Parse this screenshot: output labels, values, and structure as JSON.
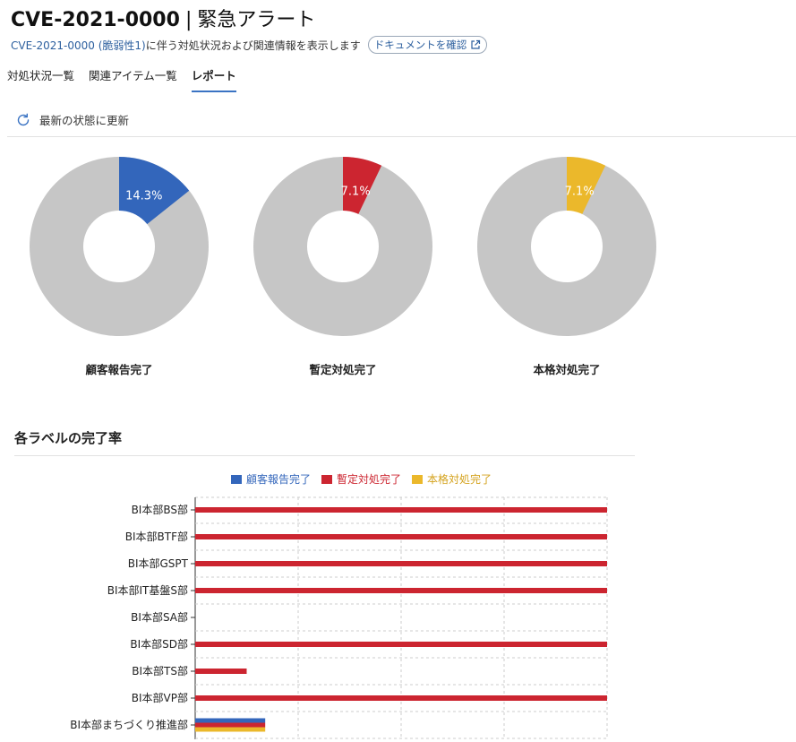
{
  "header": {
    "title_id": "CVE-2021-0000",
    "title_sep": "|",
    "title_rest": "緊急アラート",
    "subtitle_link": "CVE-2021-0000 (脆弱性1)",
    "subtitle_text": "に伴う対処状況および関連情報を表示します",
    "doc_button": "ドキュメントを確認"
  },
  "tabs": [
    {
      "label": "対処状況一覧",
      "active": false
    },
    {
      "label": "関連アイテム一覧",
      "active": false
    },
    {
      "label": "レポート",
      "active": true
    }
  ],
  "refresh_label": "最新の状態に更新",
  "colors": {
    "customer": "#3366bb",
    "interim": "#cc2530",
    "full": "#ebb82b",
    "remaining": "#c6c6c6",
    "accent": "#3a73c3"
  },
  "donuts": [
    {
      "label": "顧客報告完了",
      "pct_text": "14.3%",
      "value": 0.143,
      "color": "#3366bb"
    },
    {
      "label": "暫定対処完了",
      "pct_text": "7.1%",
      "value": 0.071,
      "color": "#cc2530"
    },
    {
      "label": "本格対処完了",
      "pct_text": "7.1%",
      "value": 0.071,
      "color": "#ebb82b"
    }
  ],
  "section_title": "各ラベルの完了率",
  "chart_data": {
    "type": "bar",
    "orientation": "horizontal",
    "categories": [
      "BI本部BS部",
      "BI本部BTF部",
      "BI本部GSPT",
      "BI本部IT基盤S部",
      "BI本部SA部",
      "BI本部SD部",
      "BI本部TS部",
      "BI本部VP部",
      "BI本部まちづくり推進部"
    ],
    "series": [
      {
        "name": "顧客報告完了",
        "color": "#3366bb",
        "values": [
          0,
          0,
          0,
          0,
          0,
          0,
          0,
          0,
          0.17
        ]
      },
      {
        "name": "暫定対処完了",
        "color": "#cc2530",
        "values": [
          1,
          1,
          1,
          1,
          0,
          1,
          0.125,
          1,
          0.17
        ]
      },
      {
        "name": "本格対処完了",
        "color": "#ebb82b",
        "values": [
          0,
          0,
          0,
          0,
          0,
          0,
          0,
          0,
          0.17
        ]
      }
    ],
    "xlim": [
      0,
      1
    ],
    "grid": true,
    "legend_position": "top"
  }
}
